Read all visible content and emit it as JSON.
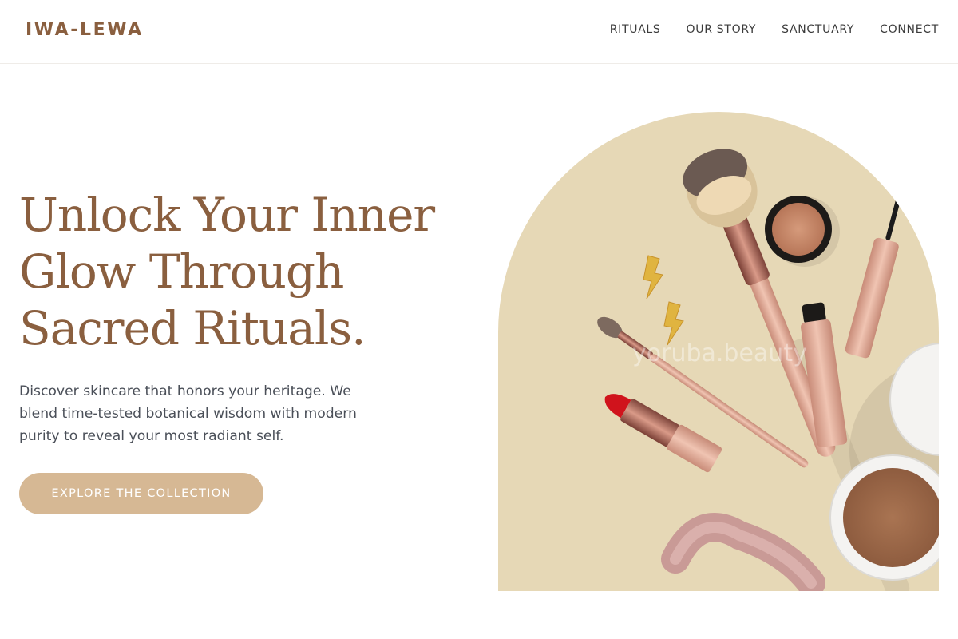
{
  "brand": {
    "name": "IWA-LEWA"
  },
  "nav": {
    "items": [
      {
        "label": "RITUALS"
      },
      {
        "label": "OUR STORY"
      },
      {
        "label": "SANCTUARY"
      },
      {
        "label": "CONNECT"
      }
    ]
  },
  "hero": {
    "title_lines": [
      "Unlock Your Inner",
      "Glow Through",
      "Sacred Rituals."
    ],
    "subtitle": "Discover skincare that honors your heritage. We blend time-tested botanical wisdom with modern purity to reveal your most radiant self.",
    "cta_label": "EXPLORE THE COLLECTION",
    "image_watermark": "yoruba.beauty"
  },
  "colors": {
    "brand": "#8a5f3f",
    "cta": "#d6b894",
    "image_background": "#e6d8b6",
    "body_text": "#4a4f58"
  }
}
